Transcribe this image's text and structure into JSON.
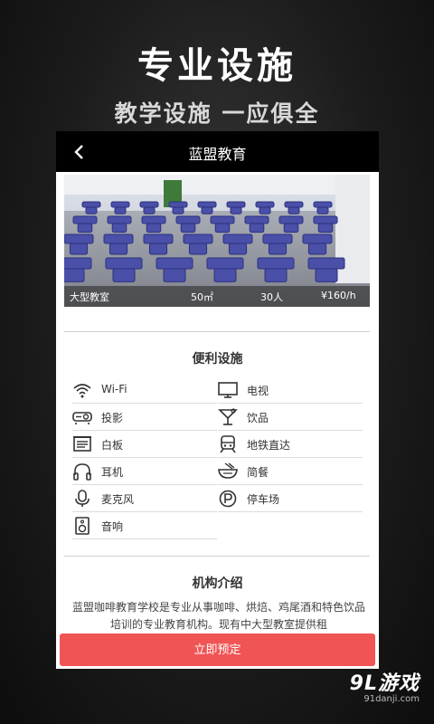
{
  "promo": {
    "title": "专业设施",
    "subtitle": "教学设施 一应俱全"
  },
  "navbar": {
    "title": "蓝盟教育",
    "back_icon": "chevron-left-icon"
  },
  "room": {
    "name": "大型教室",
    "area": "50㎡",
    "capacity": "30人",
    "price": "¥160/h"
  },
  "facilities": {
    "title": "便利设施",
    "items": [
      {
        "label": "Wi-Fi",
        "icon": "wifi-icon"
      },
      {
        "label": "电视",
        "icon": "tv-icon"
      },
      {
        "label": "投影",
        "icon": "projector-icon"
      },
      {
        "label": "饮品",
        "icon": "cocktail-icon"
      },
      {
        "label": "白板",
        "icon": "whiteboard-icon"
      },
      {
        "label": "地铁直达",
        "icon": "subway-icon"
      },
      {
        "label": "耳机",
        "icon": "headphones-icon"
      },
      {
        "label": "简餐",
        "icon": "bowl-icon"
      },
      {
        "label": "麦克风",
        "icon": "microphone-icon"
      },
      {
        "label": "停车场",
        "icon": "parking-icon"
      },
      {
        "label": "音响",
        "icon": "speaker-icon"
      }
    ]
  },
  "about": {
    "title": "机构介绍",
    "text": "蓝盟咖啡教育学校是专业从事咖啡、烘焙、鸡尾酒和特色饮品培训的专业教育机构。现有中大型教室提供租"
  },
  "book_button": "立即预定",
  "watermark": {
    "logo": "9L游戏",
    "url": "91danji.com"
  },
  "colors": {
    "accent": "#f05454",
    "navbar": "#000000",
    "chair": "#4a4fa8"
  }
}
